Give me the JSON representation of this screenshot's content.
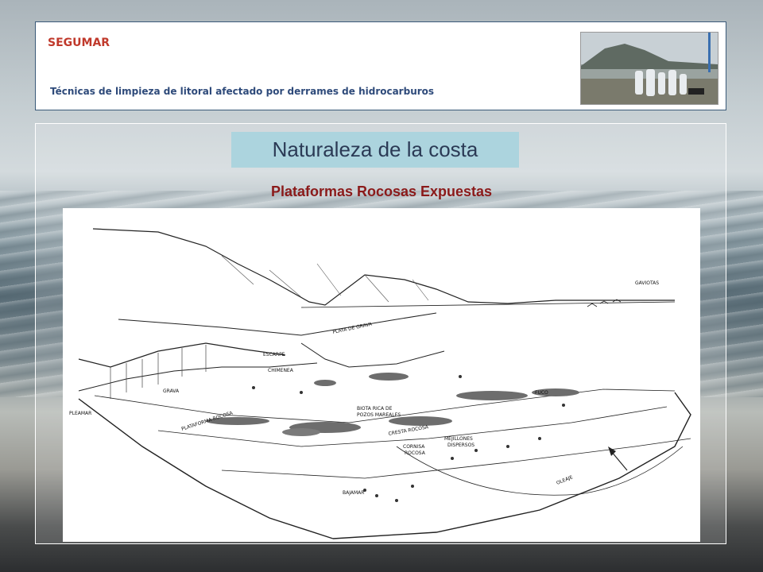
{
  "header": {
    "brand": "SEGUMAR",
    "subtitle": "Técnicas de limpieza de litoral afectado por derrames de hidrocarburos"
  },
  "section": {
    "title": "Naturaleza de la costa",
    "diagram_title": "Plataformas Rocosas Expuestas"
  },
  "diagram": {
    "labels": {
      "gaviotas": "GAVIOTAS",
      "playa_grava": "PLAYA DE GRAVA",
      "escarpe": "ESCARPE",
      "chimenea": "CHIMENEA",
      "grava": "GRAVA",
      "pleamar": "PLEAMAR",
      "plataforma": "PLATAFORMA ROCOSA",
      "biota_1": "BIOTA RICA DE",
      "biota_2": "POZOS MAREALES",
      "cresta": "CRESTA ROCOSA",
      "fuco": "FUCO",
      "mejillones_1": "MEJILLONES",
      "mejillones_2": "DISPERSOS",
      "cornisa_1": "CORNISA",
      "cornisa_2": "ROCOSA",
      "bajamar": "BAJAMAR",
      "oleaje": "OLEAJE"
    }
  }
}
